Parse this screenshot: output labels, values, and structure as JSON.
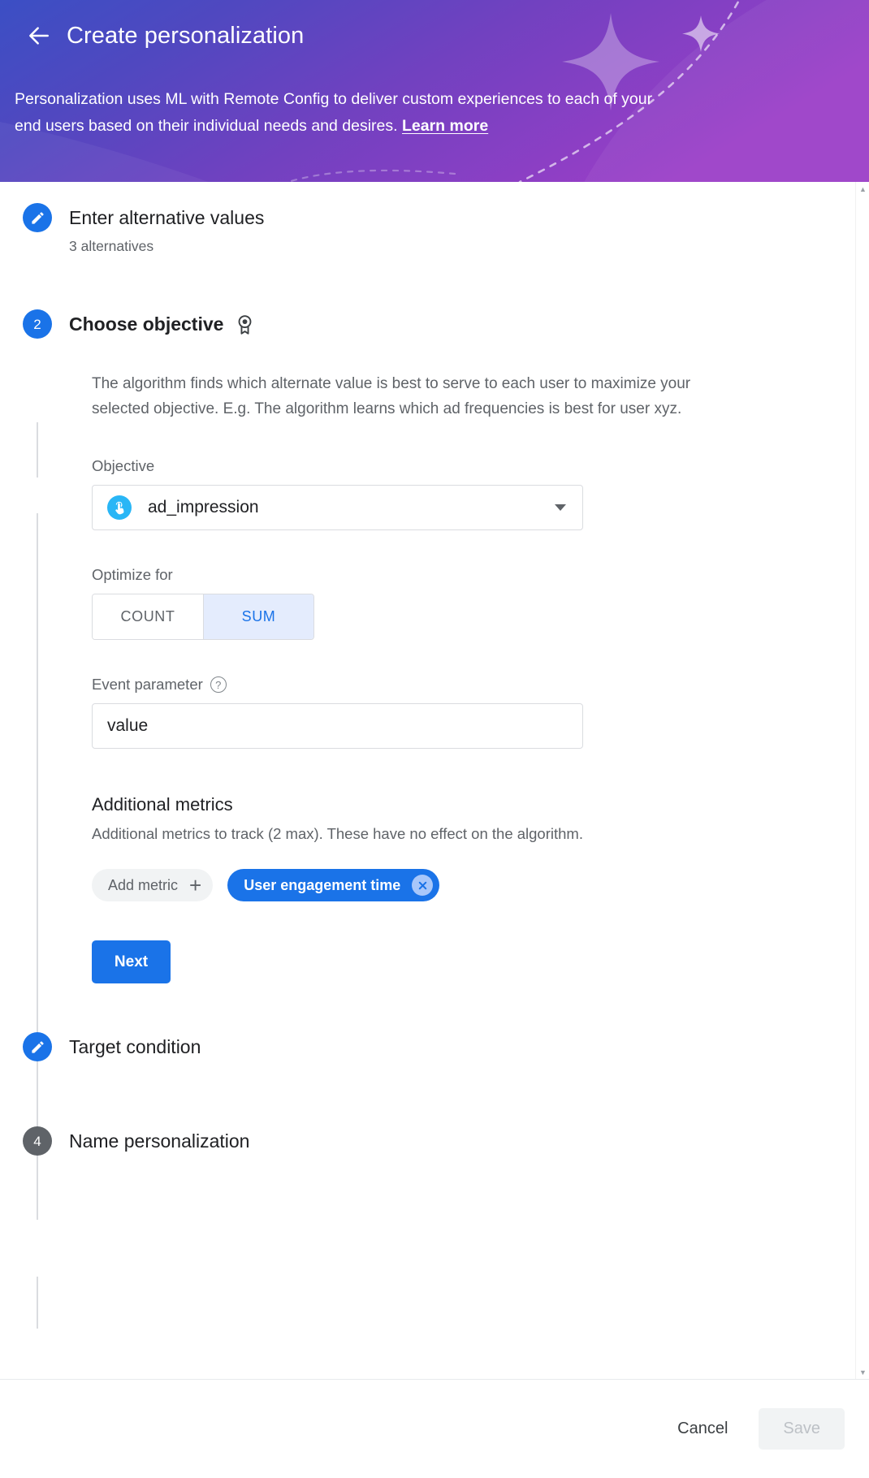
{
  "header": {
    "back_icon": "back-arrow-icon",
    "title": "Create personalization",
    "description_part1": "Personalization uses ML with Remote Config to deliver custom experiences to each of your end users based on their individual needs and desires.",
    "learn_more": "Learn more",
    "gradient_from": "#3b4fc4",
    "gradient_to": "#9a3ec6"
  },
  "steps": {
    "step1": {
      "bullet_icon": "pencil-icon",
      "title": "Enter alternative values",
      "subtitle": "3 alternatives"
    },
    "step2": {
      "number": "2",
      "title": "Choose objective",
      "badge_icon": "award-medal-icon",
      "description": "The algorithm finds which alternate value is best to serve to each user to maximize your selected objective. E.g. The algorithm learns which ad frequencies is best for user xyz.",
      "objective": {
        "label": "Objective",
        "icon": "tap-touch-icon",
        "value": "ad_impression",
        "caret_icon": "chevron-down-icon"
      },
      "optimize": {
        "label": "Optimize for",
        "options": [
          "COUNT",
          "SUM"
        ],
        "selected": "SUM"
      },
      "event_parameter": {
        "label": "Event parameter",
        "help_icon": "help-circle-icon",
        "value": "value",
        "placeholder": "Event parameter"
      },
      "additional_metrics": {
        "title": "Additional metrics",
        "subtitle": "Additional metrics to track (2 max). These have no effect on the algorithm.",
        "add_chip_label": "Add metric",
        "add_chip_icon": "plus-icon",
        "selected_chips": [
          {
            "label": "User engagement time",
            "remove_icon": "close-circle-icon"
          }
        ]
      },
      "next_label": "Next"
    },
    "step3": {
      "bullet_icon": "pencil-icon",
      "title": "Target condition"
    },
    "step4": {
      "number": "4",
      "title": "Name personalization"
    }
  },
  "footer": {
    "cancel_label": "Cancel",
    "save_label": "Save"
  },
  "scrollbar": {
    "up_icon": "scroll-up-arrow-icon",
    "down_icon": "scroll-down-arrow-icon"
  },
  "colors": {
    "accent_blue": "#1a73e8",
    "selected_toggle_bg": "#e4ecfd",
    "grey_bullet": "#5f6368"
  }
}
